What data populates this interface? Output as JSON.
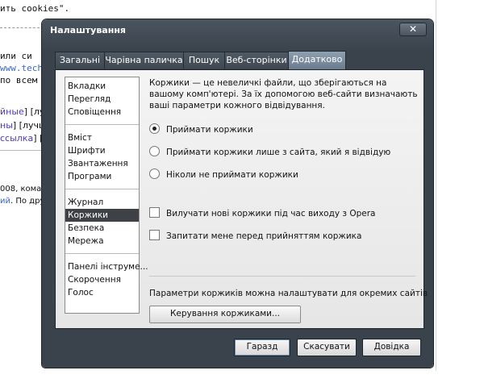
{
  "background_page": {
    "line1": "ить cookies\".",
    "line2_text": "или си",
    "line3_url": "www.tech",
    "line4_text": "по всем",
    "line5_link": "йные",
    "line5_rest": "] [лу",
    "line6_link": "ны",
    "line6_rest": "] [лучш",
    "line7_link": "ссылка",
    "line7_rest": "] [",
    "line8_text": "008, коман",
    "line9_link": "ий",
    "line9_rest": ". По други"
  },
  "dialog": {
    "title": "Налаштування",
    "close_symbol": "✕",
    "tabs": [
      {
        "label": "Загальні"
      },
      {
        "label": "Чарівна паличка"
      },
      {
        "label": "Пошук"
      },
      {
        "label": "Веб-сторінки"
      },
      {
        "label": "Додатково",
        "active": true
      }
    ],
    "sidebar": {
      "groups": [
        [
          "Вкладки",
          "Перегляд",
          "Сповіщення"
        ],
        [
          "Вміст",
          "Шрифти",
          "Звантаження",
          "Програми"
        ],
        [
          "Журнал",
          "Коржики",
          "Безпека",
          "Мережа"
        ],
        [
          "Панелі інструме...",
          "Скорочення",
          "Голос"
        ]
      ],
      "selected": "Коржики"
    },
    "content": {
      "description": "Коржики — це невеличкі файли, що зберігаються на вашому комп'ютері. За їх допомогою веб-сайти визначають ваші параметри кожного відвідування.",
      "radio_options": [
        {
          "label": "Приймати коржики",
          "checked": true
        },
        {
          "label": "Приймати коржики лише з сайта, який я відвідую",
          "checked": false
        },
        {
          "label": "Ніколи не приймати коржики",
          "checked": false
        }
      ],
      "checkboxes": [
        {
          "label": "Вилучати нові коржики під час виходу з Opera",
          "checked": false
        },
        {
          "label": "Запитати мене перед прийняттям коржика",
          "checked": false
        }
      ],
      "site_note": "Параметри коржиків можна налаштувати для окремих сайтів",
      "manage_button": "Керування коржиками..."
    },
    "buttons": {
      "ok": "Гаразд",
      "cancel": "Скасувати",
      "help": "Довідка"
    }
  },
  "colors": {
    "dialog_frame": "#3a434c",
    "active_tab": "#7f90a2",
    "selected_item": "#3e4146",
    "link": "#4a3bb5"
  }
}
